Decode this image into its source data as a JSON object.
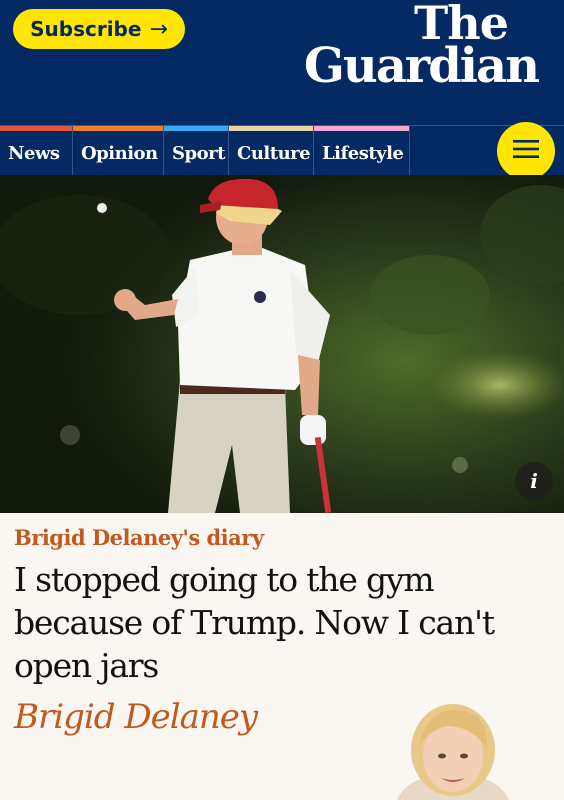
{
  "header": {
    "subscribe_label": "Subscribe",
    "subscribe_arrow": "→",
    "logo_line1": "The",
    "logo_line2": "Guardian"
  },
  "nav": {
    "items": [
      {
        "label": "News",
        "color": "#e0583d"
      },
      {
        "label": "Opinion",
        "color": "#ec7e2f"
      },
      {
        "label": "Sport",
        "color": "#3aa9ef"
      },
      {
        "label": "Culture",
        "color": "#e6d3a6"
      },
      {
        "label": "Lifestyle",
        "color": "#f5a8d2"
      }
    ],
    "menu_icon": "hamburger-icon"
  },
  "hero": {
    "info_label": "i",
    "info_icon": "info-icon"
  },
  "article": {
    "kicker": "Brigid Delaney's diary",
    "headline": "I stopped going to the gym because of Trump. Now I can't open jars",
    "byline": "Brigid Delaney"
  },
  "colors": {
    "brand_blue": "#052962",
    "accent_yellow": "#ffe500",
    "opinion_orange": "#c05a1f",
    "page_background": "#faf7f2"
  }
}
